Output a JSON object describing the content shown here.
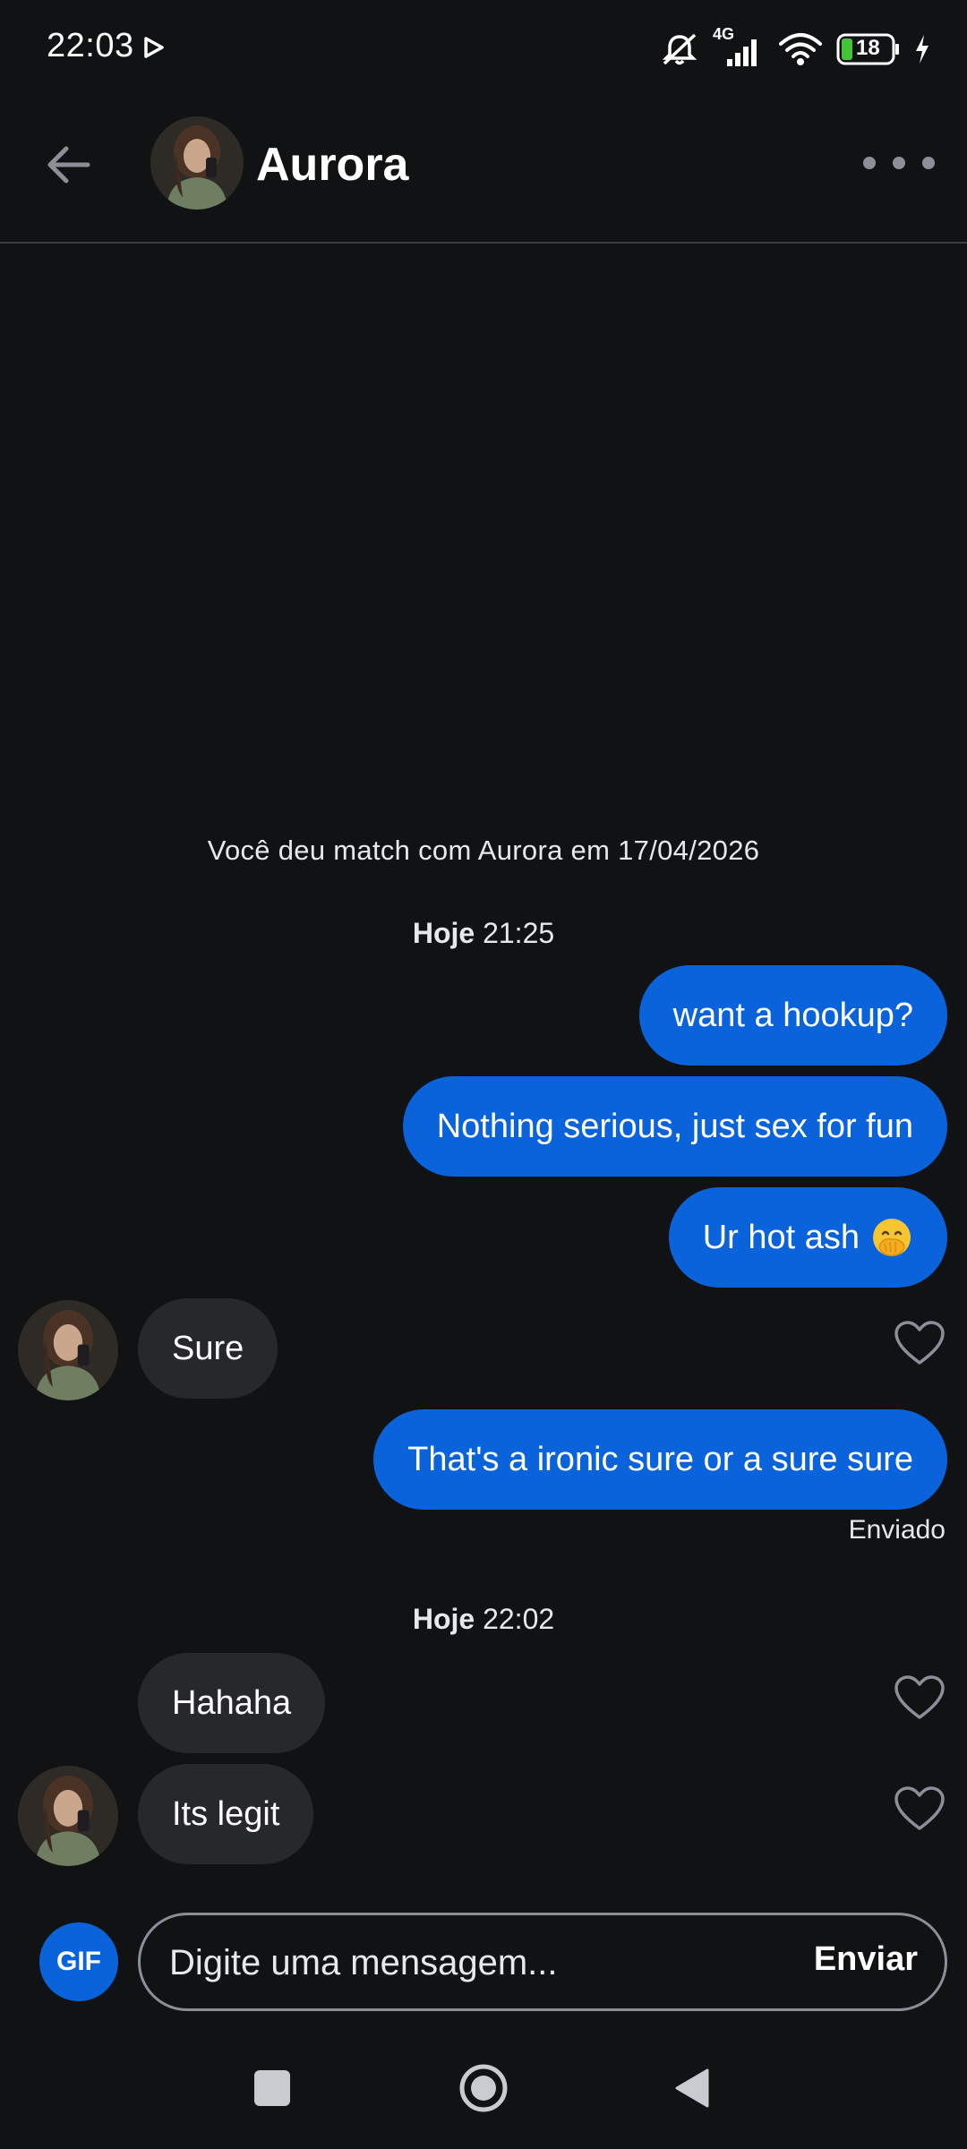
{
  "status_bar": {
    "time": "22:03",
    "network": "4G",
    "battery": "18",
    "icons": [
      "play-icon",
      "mute-icon",
      "signal-icon",
      "wifi-icon",
      "battery-icon",
      "charging-icon"
    ]
  },
  "header": {
    "name": "Aurora",
    "icons": [
      "back-arrow-icon",
      "more-options-icon"
    ]
  },
  "chat": {
    "match_notice": "Você deu match com Aurora em 17/04/2026",
    "groups": [
      {
        "day": "Hoje",
        "time": "21:25",
        "messages": [
          {
            "direction": "sent",
            "text": "want a hookup?"
          },
          {
            "direction": "sent",
            "text": "Nothing serious, just sex for fun"
          },
          {
            "direction": "sent",
            "text": "Ur hot ash",
            "emoji": "face-with-hand-over-mouth"
          },
          {
            "direction": "received",
            "text": "Sure"
          },
          {
            "direction": "sent",
            "text": "That's a ironic sure or a sure sure",
            "status": "Enviado"
          }
        ]
      },
      {
        "day": "Hoje",
        "time": "22:02",
        "messages": [
          {
            "direction": "received",
            "text": "Hahaha"
          },
          {
            "direction": "received",
            "text": "Its legit"
          }
        ]
      }
    ]
  },
  "composer": {
    "gif_label": "GIF",
    "placeholder": "Digite uma mensagem...",
    "value": "",
    "send_label": "Enviar"
  },
  "colors": {
    "background": "#111214",
    "sent_bubble": "#0a63db",
    "received_bubble": "#27282c",
    "accent": "#0a63db"
  }
}
